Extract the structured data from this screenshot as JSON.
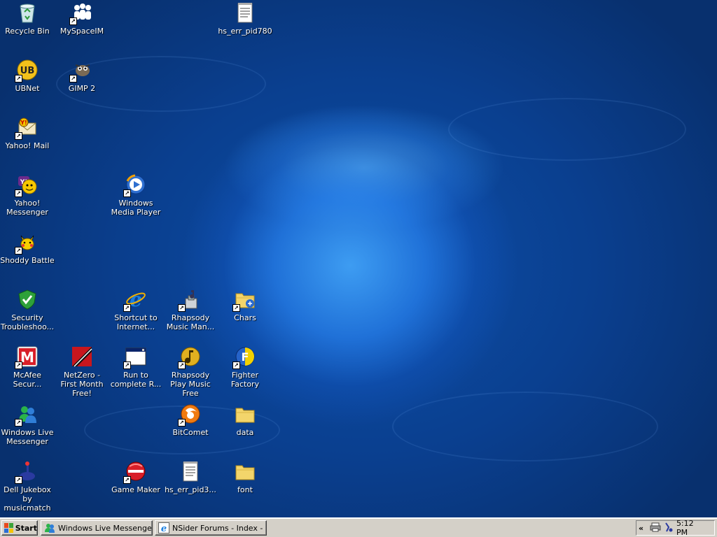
{
  "desktop": {
    "icons": [
      {
        "label": "Recycle Bin",
        "icon": "recycle-bin-icon"
      },
      {
        "label": "MySpaceIM",
        "icon": "myspaceim-icon"
      },
      {
        "label": "hs_err_pid780",
        "icon": "text-file-icon"
      },
      {
        "label": "UBNet",
        "icon": "ubnet-icon"
      },
      {
        "label": "GIMP 2",
        "icon": "gimp-icon"
      },
      {
        "label": "Yahoo! Mail",
        "icon": "yahoo-mail-icon"
      },
      {
        "label": "Yahoo! Messenger",
        "icon": "yahoo-messenger-icon"
      },
      {
        "label": "Windows Media Player",
        "icon": "windows-media-player-icon"
      },
      {
        "label": "Shoddy Battle",
        "icon": "shoddy-battle-icon"
      },
      {
        "label": "Security Troubleshoo...",
        "icon": "security-shield-icon"
      },
      {
        "label": "Shortcut to Internet...",
        "icon": "internet-explorer-icon"
      },
      {
        "label": "Rhapsody Music Man...",
        "icon": "rhapsody-icon"
      },
      {
        "label": "Chars",
        "icon": "folder-icon"
      },
      {
        "label": "McAfee Secur...",
        "icon": "mcafee-icon"
      },
      {
        "label": "NetZero - First Month Free!",
        "icon": "netzero-icon"
      },
      {
        "label": "Run to complete R...",
        "icon": "program-window-icon"
      },
      {
        "label": "Rhapsody Play Music Free",
        "icon": "rhapsody-play-icon"
      },
      {
        "label": "Fighter Factory",
        "icon": "fighter-factory-icon"
      },
      {
        "label": "Windows Live Messenger",
        "icon": "windows-live-messenger-icon"
      },
      {
        "label": "BitComet",
        "icon": "bitcomet-icon"
      },
      {
        "label": "data",
        "icon": "folder-icon"
      },
      {
        "label": "Dell Jukebox by musicmatch",
        "icon": "dell-jukebox-icon"
      },
      {
        "label": "Game Maker",
        "icon": "game-maker-icon"
      },
      {
        "label": "hs_err_pid3...",
        "icon": "text-file-icon"
      },
      {
        "label": "font",
        "icon": "folder-icon"
      }
    ]
  },
  "taskbar": {
    "start_label": "Start",
    "tasks": [
      {
        "label": "Windows Live Messenger",
        "icon": "windows-live-messenger-icon"
      },
      {
        "label": "NSider Forums - Index - ...",
        "icon": "internet-explorer-icon"
      }
    ],
    "tray": {
      "chevron": "«",
      "clock": "5:12 PM",
      "icons": [
        "printer-icon",
        "network-icon"
      ]
    }
  },
  "colors": {
    "wallpaper": "#0a3f8f",
    "taskbar": "#d4d0c8"
  }
}
